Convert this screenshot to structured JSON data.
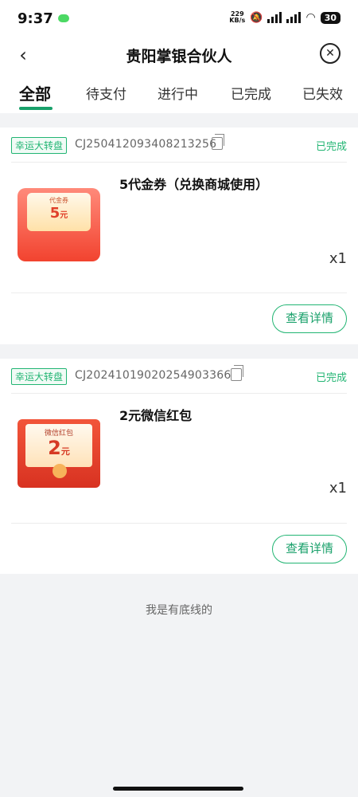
{
  "status_bar": {
    "time": "9:37",
    "net_speed_value": "229",
    "net_speed_unit": "KB/s",
    "battery": "30"
  },
  "nav": {
    "title": "贵阳掌银合伙人"
  },
  "tabs": [
    {
      "label": "全部",
      "active": true
    },
    {
      "label": "待支付",
      "active": false
    },
    {
      "label": "进行中",
      "active": false
    },
    {
      "label": "已完成",
      "active": false
    },
    {
      "label": "已失效",
      "active": false
    }
  ],
  "orders": [
    {
      "tag": "幸运大转盘",
      "order_no": "CJ250412093408213256",
      "status": "已完成",
      "product": "5代金券（兑换商城使用）",
      "thumb_label": "代金券",
      "thumb_value": "5",
      "thumb_unit": "元",
      "qty": "x1",
      "detail_button": "查看详情"
    },
    {
      "tag": "幸运大转盘",
      "order_no": "CJ20241019020254903366",
      "status": "已完成",
      "product": "2元微信红包",
      "thumb_label": "微信红包",
      "thumb_value": "2",
      "thumb_unit": "元",
      "qty": "x1",
      "detail_button": "查看详情"
    }
  ],
  "footer": {
    "text": "我是有底线的"
  },
  "colors": {
    "accent": "#22b573",
    "accent_dark": "#18a06a",
    "page_bg": "#f2f3f5"
  }
}
